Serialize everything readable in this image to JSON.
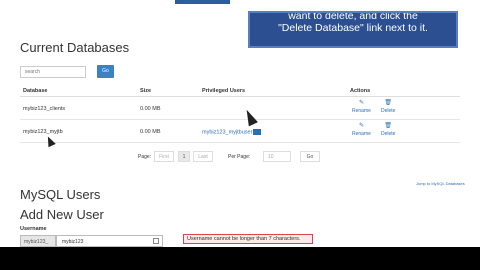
{
  "tooltip": {
    "line1": "want to delete, and click the",
    "line2": "\"Delete Database\" link next to it."
  },
  "current_databases": {
    "title": "Current Databases",
    "search_placeholder": "search",
    "go_label": "Go",
    "columns": [
      "Database",
      "Size",
      "Privileged Users",
      "Actions"
    ],
    "rows": [
      {
        "database": "mybiz123_clients",
        "size": "0.00 MB",
        "users": "",
        "rename": "Rename",
        "delete": "Delete"
      },
      {
        "database": "mybiz123_myjtb",
        "size": "0.00 MB",
        "users": "mybiz123_myjtbuser",
        "rename": "Rename",
        "delete": "Delete"
      }
    ]
  },
  "pager": {
    "page_label": "Page:",
    "first": "First",
    "current": "1",
    "last": "Last",
    "per_page_label": "Per Page:",
    "per_page_value": "10",
    "go_label": "Go",
    "jump": "Jump to MySQL Databases"
  },
  "mysql_users": {
    "title": "MySQL Users",
    "add_title": "Add New User",
    "username_label": "Username",
    "prefix": "mybiz123_",
    "username_value": "mybiz123",
    "warning": "Username cannot be longer than 7 characters."
  }
}
